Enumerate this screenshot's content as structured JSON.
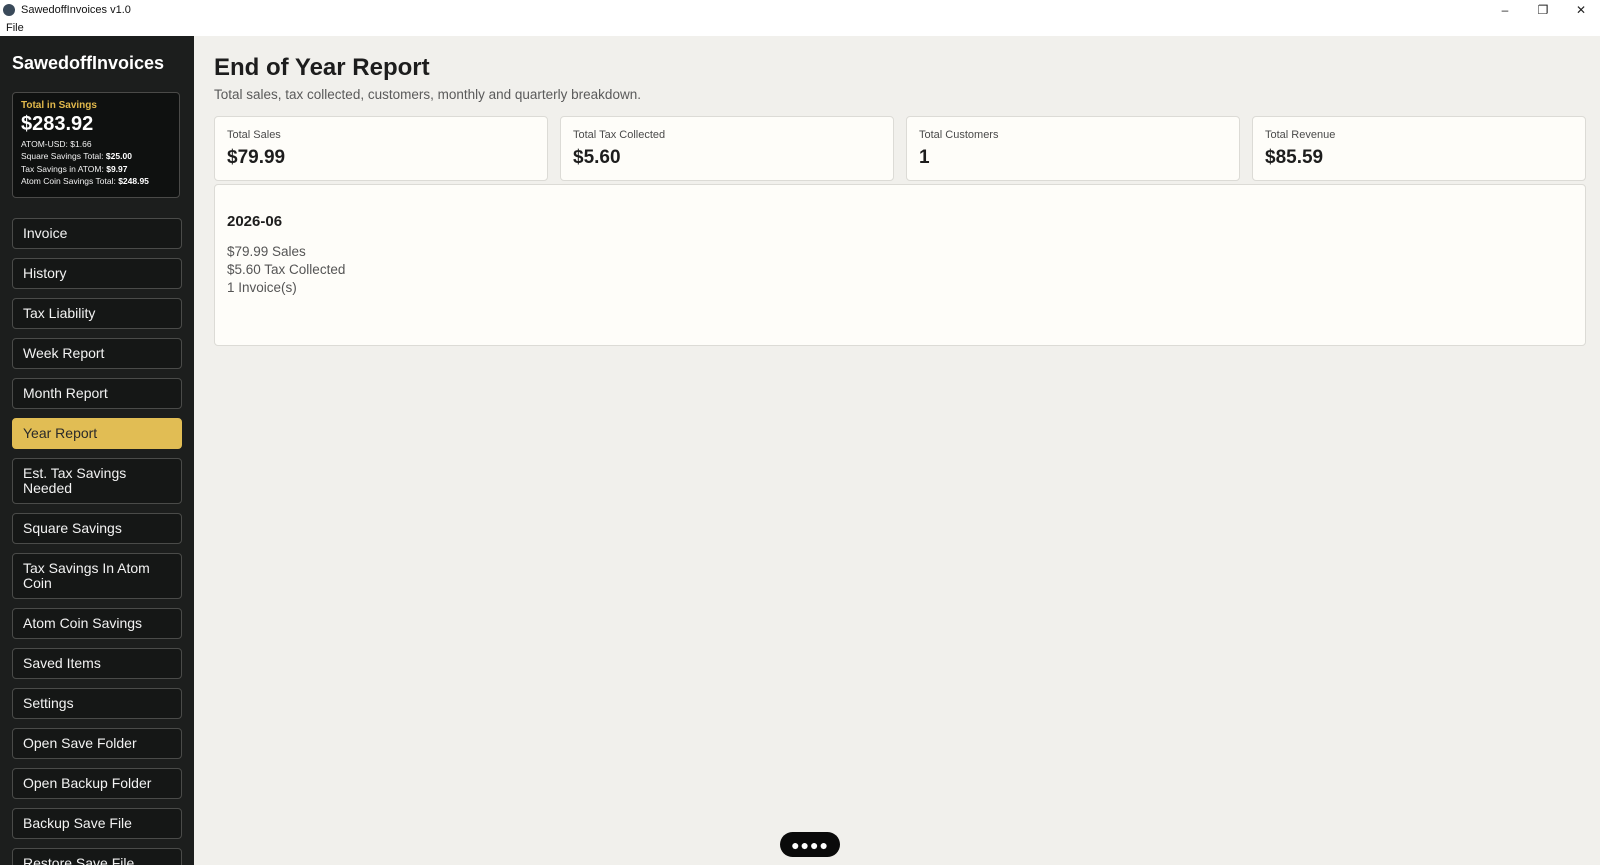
{
  "window": {
    "title": "SawedoffInvoices v1.0",
    "minimize_glyph": "–",
    "restore_glyph": "❐",
    "close_glyph": "✕"
  },
  "menu": {
    "file_label": "File"
  },
  "sidebar": {
    "brand": "SawedoffInvoices",
    "savings": {
      "title": "Total in Savings",
      "amount": "$283.92",
      "atom_usd": "ATOM-USD: $1.66",
      "square_label": "Square Savings Total:",
      "square_value": "$25.00",
      "tax_atom_label": "Tax Savings in ATOM:",
      "tax_atom_value": "$9.97",
      "atom_coin_label": "Atom Coin Savings Total:",
      "atom_coin_value": "$248.95"
    },
    "items": [
      {
        "label": "Invoice"
      },
      {
        "label": "History"
      },
      {
        "label": "Tax Liability"
      },
      {
        "label": "Week Report"
      },
      {
        "label": "Month Report"
      },
      {
        "label": "Year Report"
      },
      {
        "label": "Est. Tax Savings Needed"
      },
      {
        "label": "Square Savings"
      },
      {
        "label": "Tax Savings In Atom Coin"
      },
      {
        "label": "Atom Coin Savings"
      },
      {
        "label": "Saved Items"
      },
      {
        "label": "Settings"
      },
      {
        "label": "Open Save Folder"
      },
      {
        "label": "Open Backup Folder"
      },
      {
        "label": "Backup Save File"
      },
      {
        "label": "Restore Save File"
      }
    ],
    "active_item": "Year Report"
  },
  "main": {
    "title": "End of Year Report",
    "subtitle": "Total sales, tax collected, customers, monthly and quarterly breakdown.",
    "stats": [
      {
        "label": "Total Sales",
        "value": "$79.99"
      },
      {
        "label": "Total Tax Collected",
        "value": "$5.60"
      },
      {
        "label": "Total Customers",
        "value": "1"
      },
      {
        "label": "Total Revenue",
        "value": "$85.59"
      }
    ],
    "months": [
      {
        "period": "2026-06",
        "sales": "$79.99 Sales",
        "tax": "$5.60 Tax Collected",
        "invoices": "1 Invoice(s)"
      }
    ]
  },
  "drag_handle": {
    "glyph": "●●●●"
  },
  "colors": {
    "sidebar_bg": "#1c1e1d",
    "accent": "#e1bd54",
    "content_bg": "#f1f0ec",
    "card_bg": "#fefdf9"
  }
}
